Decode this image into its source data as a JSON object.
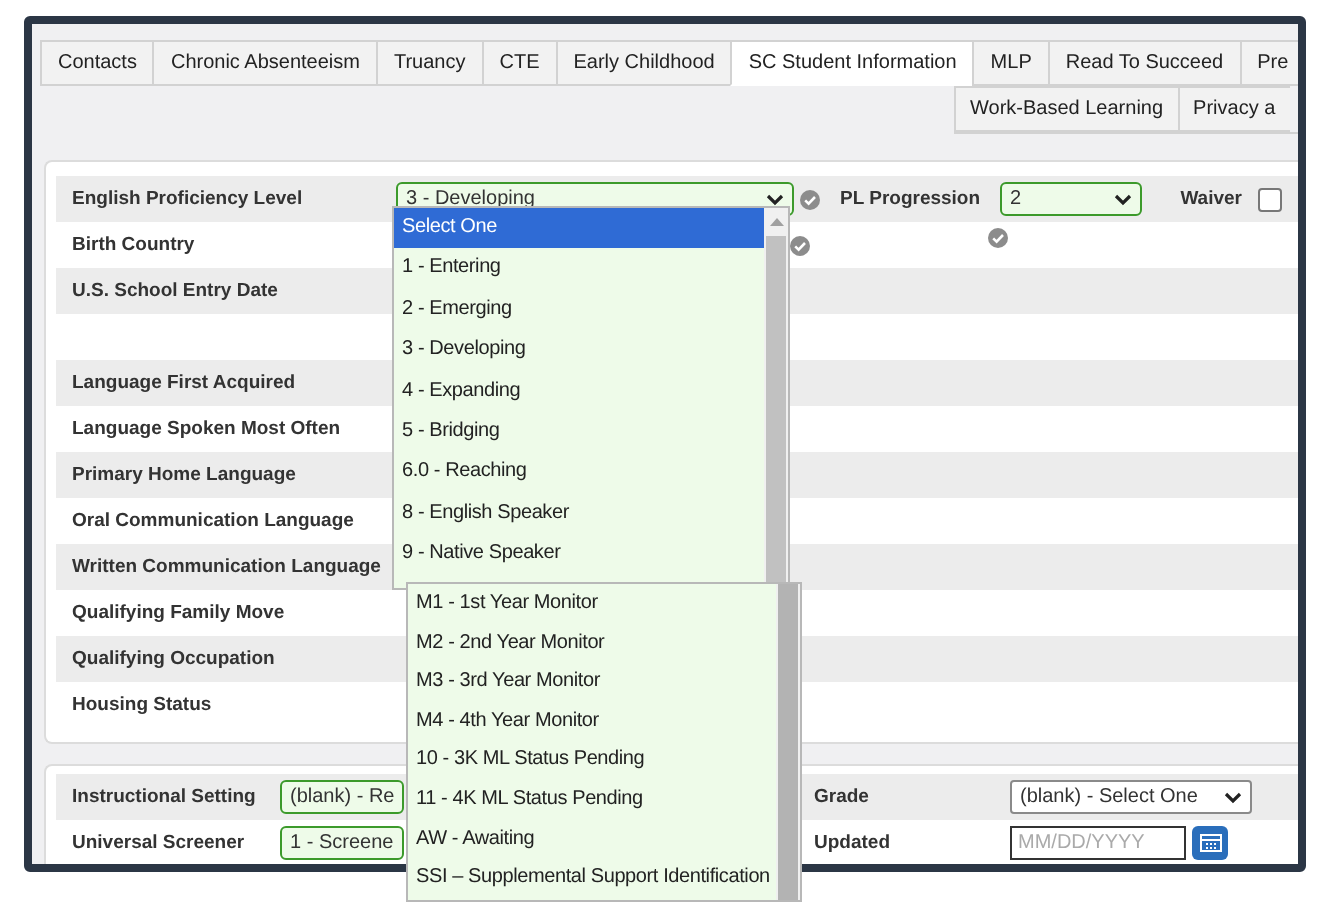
{
  "tabs": [
    {
      "label": "Contacts",
      "selected": false
    },
    {
      "label": "Chronic Absenteeism",
      "selected": false
    },
    {
      "label": "Truancy",
      "selected": false
    },
    {
      "label": "CTE",
      "selected": false
    },
    {
      "label": "Early Childhood",
      "selected": false
    },
    {
      "label": "SC Student Information",
      "selected": true
    },
    {
      "label": "MLP",
      "selected": false
    },
    {
      "label": "Read To Succeed",
      "selected": false
    },
    {
      "label": "Pre",
      "selected": false
    }
  ],
  "tabs_row_2": [
    {
      "label": "Work-Based Learning",
      "selected": false
    },
    {
      "label": "Privacy a",
      "selected": false
    }
  ],
  "top_fields": {
    "english_proficiency_value": "3 - Developing",
    "pl_progression_label": "PL Progression",
    "pl_progression_value": "2",
    "waiver_label": "Waiver",
    "waiver_checked": false
  },
  "rows": [
    {
      "label": "English Proficiency Level"
    },
    {
      "label": "Birth Country"
    },
    {
      "label": "U.S. School Entry Date"
    },
    {
      "label": "Language First Acquired"
    },
    {
      "label": "Language Spoken Most Often"
    },
    {
      "label": "Primary Home Language"
    },
    {
      "label": "Oral Communication Language"
    },
    {
      "label": "Written Communication Language"
    },
    {
      "label": "Qualifying Family Move"
    },
    {
      "label": "Qualifying Occupation"
    },
    {
      "label": "Housing Status"
    }
  ],
  "bottom_rows": [
    {
      "label": "Instructional Setting",
      "select": "(blank) - Re",
      "right_label": "Grade",
      "kind": "select",
      "right_value": "(blank) - Select One"
    },
    {
      "label": "Universal Screener",
      "select": "1 - Screene",
      "right_label": "Updated",
      "kind": "date",
      "right_placeholder": "MM/DD/YYYY"
    }
  ],
  "dropdown": {
    "options": [
      {
        "label": "Select One",
        "selected": true
      },
      {
        "label": "1 - Entering",
        "selected": false
      },
      {
        "label": "2 - Emerging",
        "selected": false
      },
      {
        "label": "3 - Developing",
        "selected": false
      },
      {
        "label": "4 - Expanding",
        "selected": false
      },
      {
        "label": "5 - Bridging",
        "selected": false
      },
      {
        "label": "6.0 - Reaching",
        "selected": false
      },
      {
        "label": "8 - English Speaker",
        "selected": false
      },
      {
        "label": "9 - Native Speaker",
        "selected": false
      }
    ]
  },
  "dropdown_lower": {
    "options": [
      {
        "label": "M1 - 1st Year Monitor",
        "selected": false
      },
      {
        "label": "M2 - 2nd Year Monitor",
        "selected": false
      },
      {
        "label": "M3 - 3rd Year Monitor",
        "selected": false
      },
      {
        "label": "M4 - 4th Year Monitor",
        "selected": false
      },
      {
        "label": "10 - 3K ML Status Pending",
        "selected": false
      },
      {
        "label": "11 - 4K ML Status Pending",
        "selected": false
      },
      {
        "label": "AW - Awaiting",
        "selected": false
      },
      {
        "label": "SSI – Supplemental Support Identification",
        "selected": false
      }
    ]
  }
}
